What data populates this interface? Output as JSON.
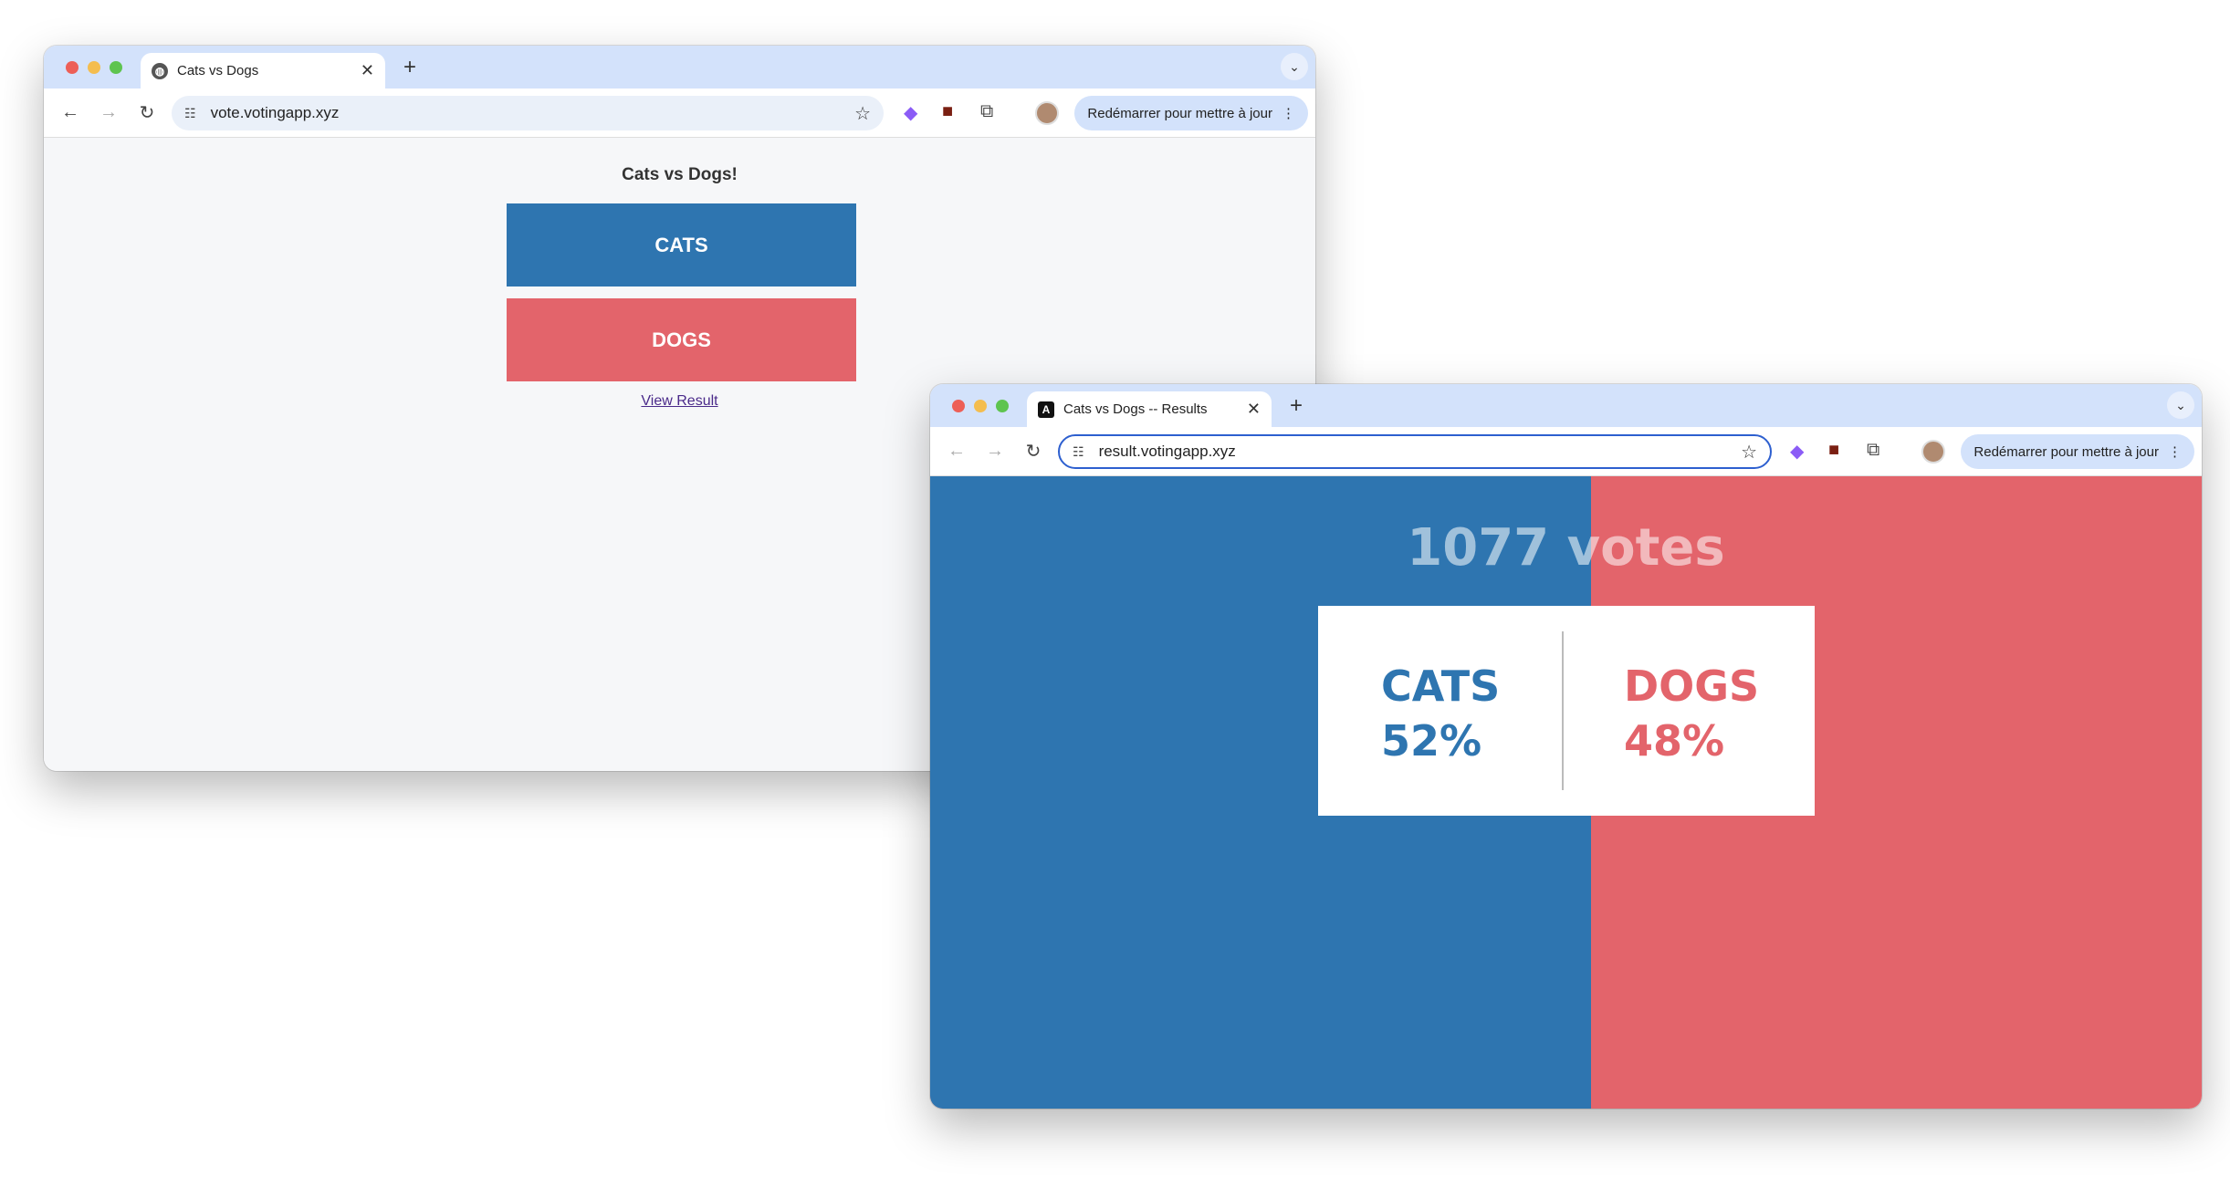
{
  "vote_window": {
    "tab_title": "Cats vs Dogs",
    "url": "vote.votingapp.xyz",
    "update_button": "Redémarrer pour mettre à jour",
    "page": {
      "heading": "Cats vs Dogs!",
      "cats_button": "CATS",
      "dogs_button": "DOGS",
      "view_result_link": "View Result"
    }
  },
  "result_window": {
    "tab_title": "Cats vs Dogs -- Results",
    "url": "result.votingapp.xyz",
    "update_button": "Redémarrer pour mettre à jour",
    "page": {
      "votes": "1077 votes",
      "cats_label": "CATS",
      "cats_percent": "52%",
      "dogs_label": "DOGS",
      "dogs_percent": "48%",
      "cats_share": 52
    }
  },
  "colors": {
    "cats": "#2e75b0",
    "dogs": "#e3646b",
    "tabbar": "#d3e2fb"
  },
  "icons": [
    "globe-icon",
    "angular-icon",
    "close-icon",
    "plus-icon",
    "back-icon",
    "forward-icon",
    "reload-icon",
    "site-settings-icon",
    "star-icon",
    "extension-icon",
    "menu-icon"
  ]
}
